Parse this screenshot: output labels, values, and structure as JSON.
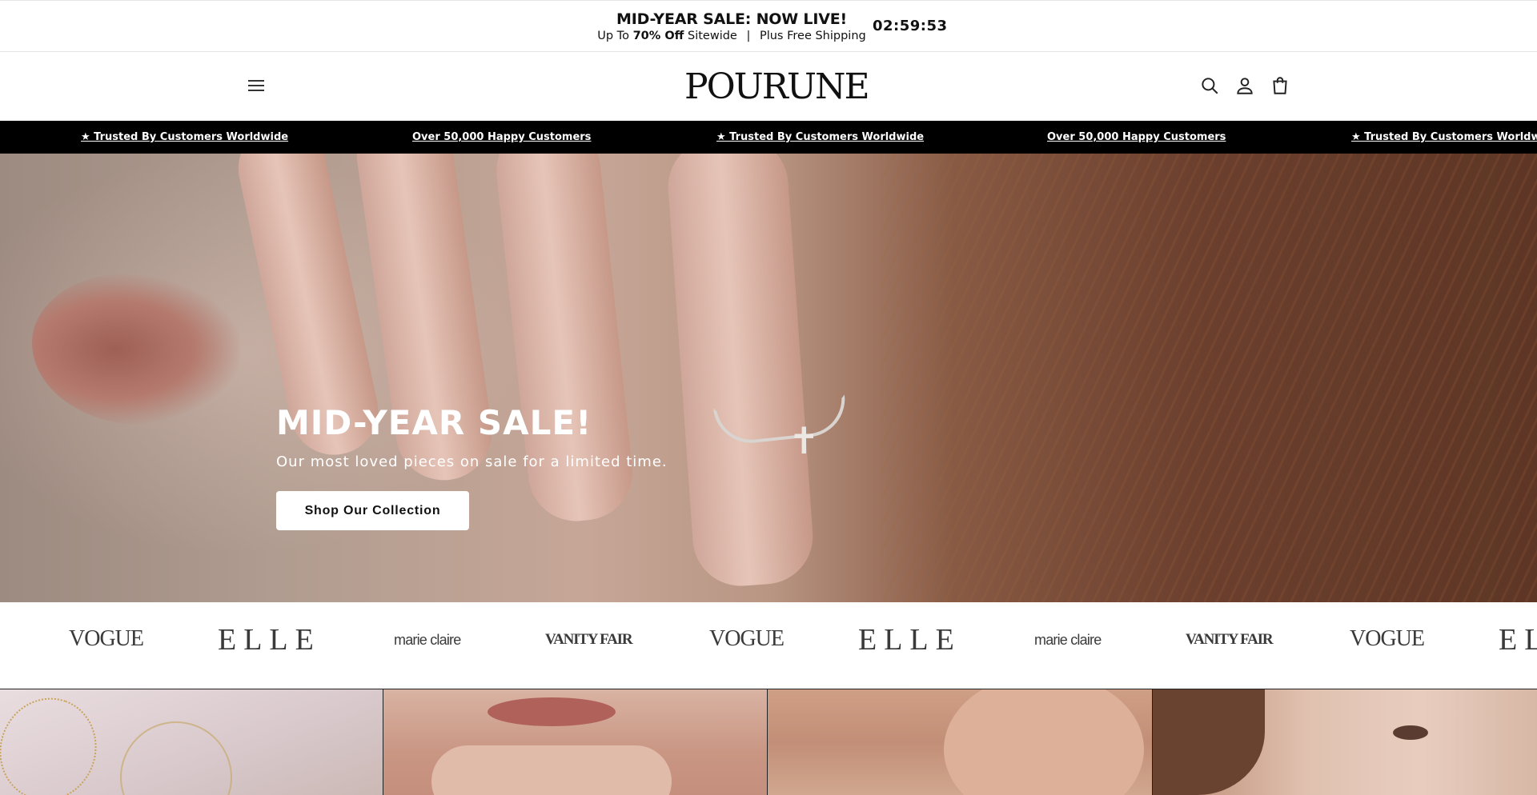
{
  "announcement": {
    "headline": "MID-YEAR SALE: NOW LIVE!",
    "sub_prefix": "Up To",
    "sub_bold": "70% Off",
    "sub_suffix": "Sitewide",
    "sub_separator": "|",
    "sub_shipping": "Plus Free Shipping",
    "countdown": "02:59:53"
  },
  "header": {
    "logo": "POURUNE",
    "icons": [
      "menu-icon",
      "search-icon",
      "account-icon",
      "cart-icon"
    ]
  },
  "trust_bar": {
    "items": [
      "★ Trusted By Customers Worldwide",
      "Over 50,000 Happy Customers",
      "★ Trusted By Customers Worldwide",
      "Over 50,000 Happy Customers",
      "★ Trusted By Customers Worldwide"
    ]
  },
  "hero": {
    "title": "MID-YEAR SALE!",
    "subtitle": "Our most loved pieces on sale for a limited time.",
    "cta": "Shop Our Collection"
  },
  "press": {
    "logos": [
      "VOGUE",
      "ELLE",
      "marie claire",
      "VANITY FAIR",
      "VOGUE",
      "ELLE",
      "marie claire",
      "VANITY FAIR",
      "VOGUE",
      "ELLE"
    ]
  },
  "colors": {
    "trust_bar_bg": "#000000",
    "cta_bg": "#ffffff"
  }
}
